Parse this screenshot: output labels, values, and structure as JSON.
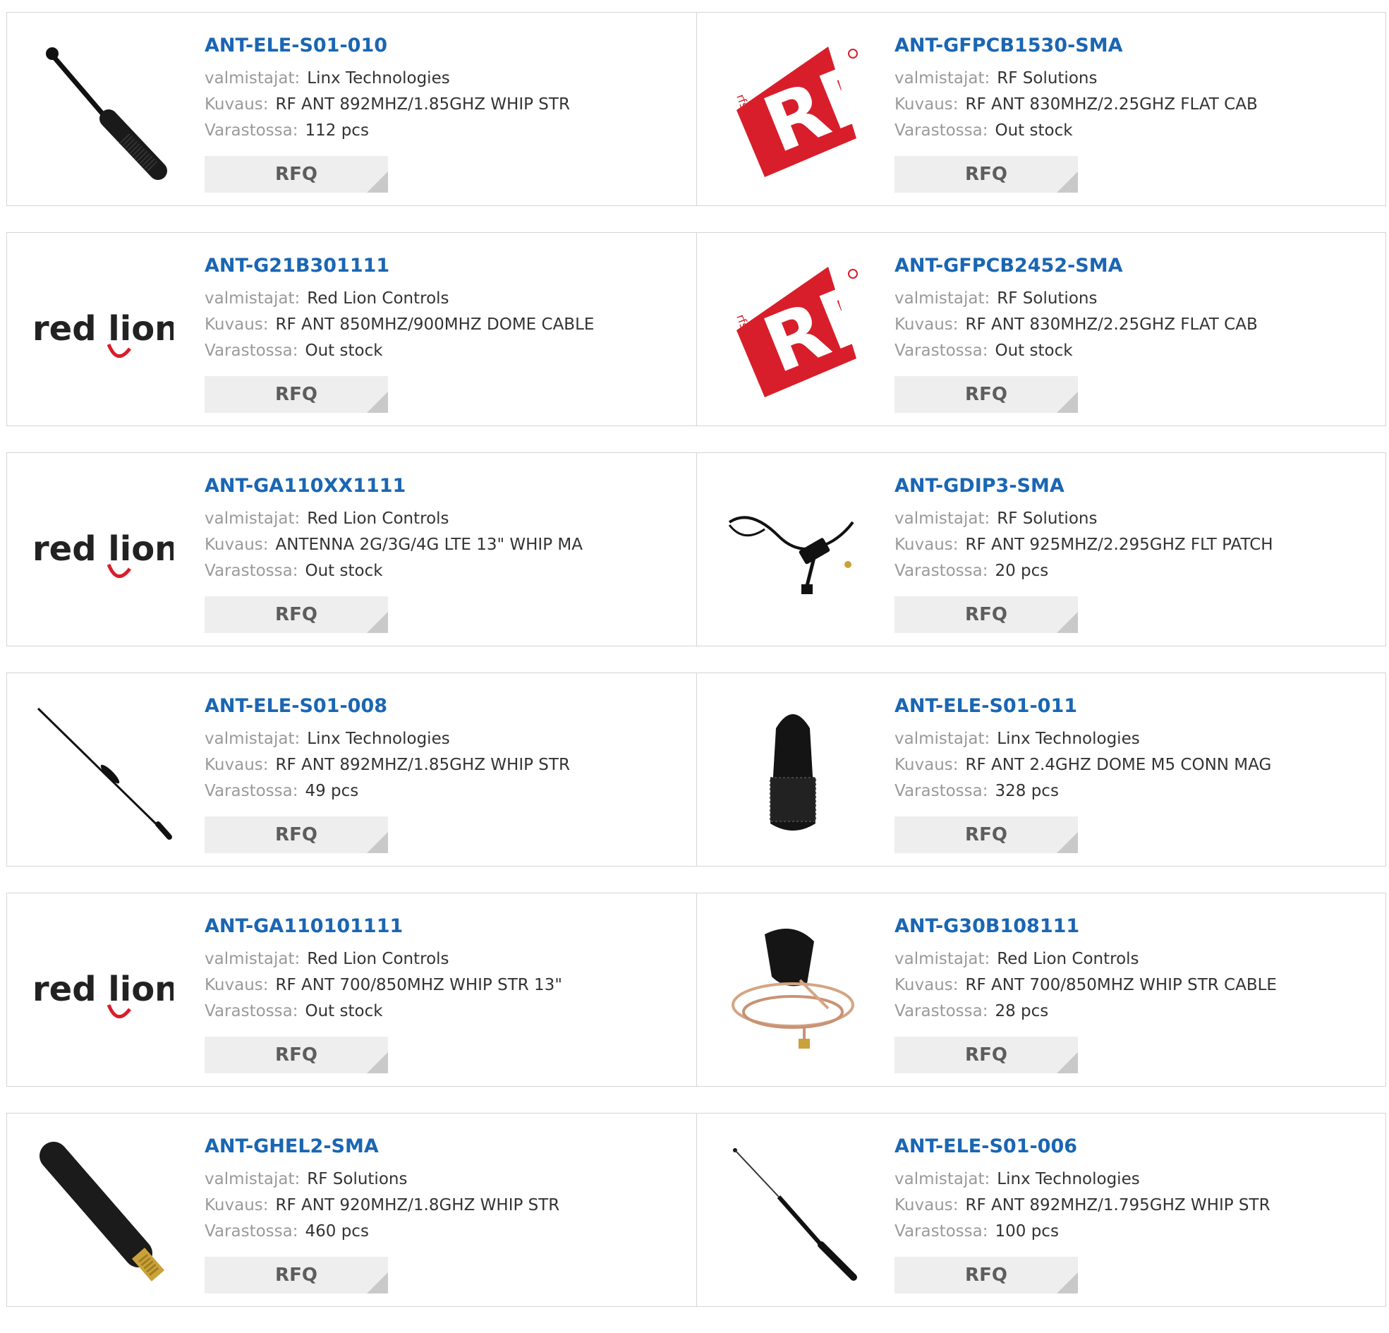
{
  "labels": {
    "manufacturer": "valmistajat:",
    "description": "Kuvaus:",
    "stock": "Varastossa:",
    "rfq": "RFQ"
  },
  "logo_text": {
    "redlion": "red lion",
    "rf": "RF",
    "rfsolutions": "rfsolutions"
  },
  "colors": {
    "link": "#1a66b3",
    "rf_red": "#d81e2a",
    "button": "#eeeeee"
  },
  "rows": [
    [
      {
        "part": "ANT-ELE-S01-010",
        "manufacturer": "Linx Technologies",
        "description": "RF ANT 892MHZ/1.85GHZ WHIP STR",
        "stock": "112 pcs",
        "image": "whip-antenna-short"
      },
      {
        "part": "ANT-GFPCB1530-SMA",
        "manufacturer": "RF Solutions",
        "description": "RF ANT 830MHZ/2.25GHZ FLAT CAB",
        "stock": "Out stock",
        "image": "rf-solutions-logo"
      }
    ],
    [
      {
        "part": "ANT-G21B301111",
        "manufacturer": "Red Lion Controls",
        "description": "RF ANT 850MHZ/900MHZ DOME CABLE",
        "stock": "Out stock",
        "image": "red-lion-logo"
      },
      {
        "part": "ANT-GFPCB2452-SMA",
        "manufacturer": "RF Solutions",
        "description": "RF ANT 830MHZ/2.25GHZ FLAT CAB",
        "stock": "Out stock",
        "image": "rf-solutions-logo"
      }
    ],
    [
      {
        "part": "ANT-GA110XX1111",
        "manufacturer": "Red Lion Controls",
        "description": "ANTENNA 2G/3G/4G LTE 13\" WHIP MA",
        "stock": "Out stock",
        "image": "red-lion-logo"
      },
      {
        "part": "ANT-GDIP3-SMA",
        "manufacturer": "RF Solutions",
        "description": "RF ANT 925MHZ/2.295GHZ FLT PATCH",
        "stock": "20 pcs",
        "image": "cable-antenna"
      }
    ],
    [
      {
        "part": "ANT-ELE-S01-008",
        "manufacturer": "Linx Technologies",
        "description": "RF ANT 892MHZ/1.85GHZ WHIP STR",
        "stock": "49 pcs",
        "image": "whip-antenna-long"
      },
      {
        "part": "ANT-ELE-S01-011",
        "manufacturer": "Linx Technologies",
        "description": "RF ANT 2.4GHZ DOME M5 CONN MAG",
        "stock": "328 pcs",
        "image": "dome-antenna"
      }
    ],
    [
      {
        "part": "ANT-GA110101111",
        "manufacturer": "Red Lion Controls",
        "description": "RF ANT 700/850MHZ WHIP STR 13\"",
        "stock": "Out stock",
        "image": "red-lion-logo"
      },
      {
        "part": "ANT-G30B108111",
        "manufacturer": "Red Lion Controls",
        "description": "RF ANT 700/850MHZ WHIP STR CABLE",
        "stock": "28 pcs",
        "image": "dome-cable-antenna"
      }
    ],
    [
      {
        "part": "ANT-GHEL2-SMA",
        "manufacturer": "RF Solutions",
        "description": "RF ANT 920MHZ/1.8GHZ WHIP STR",
        "stock": "460 pcs",
        "image": "stubby-antenna"
      },
      {
        "part": "ANT-ELE-S01-006",
        "manufacturer": "Linx Technologies",
        "description": "RF ANT 892MHZ/1.795GHZ WHIP STR",
        "stock": "100 pcs",
        "image": "telescopic-antenna"
      }
    ]
  ]
}
